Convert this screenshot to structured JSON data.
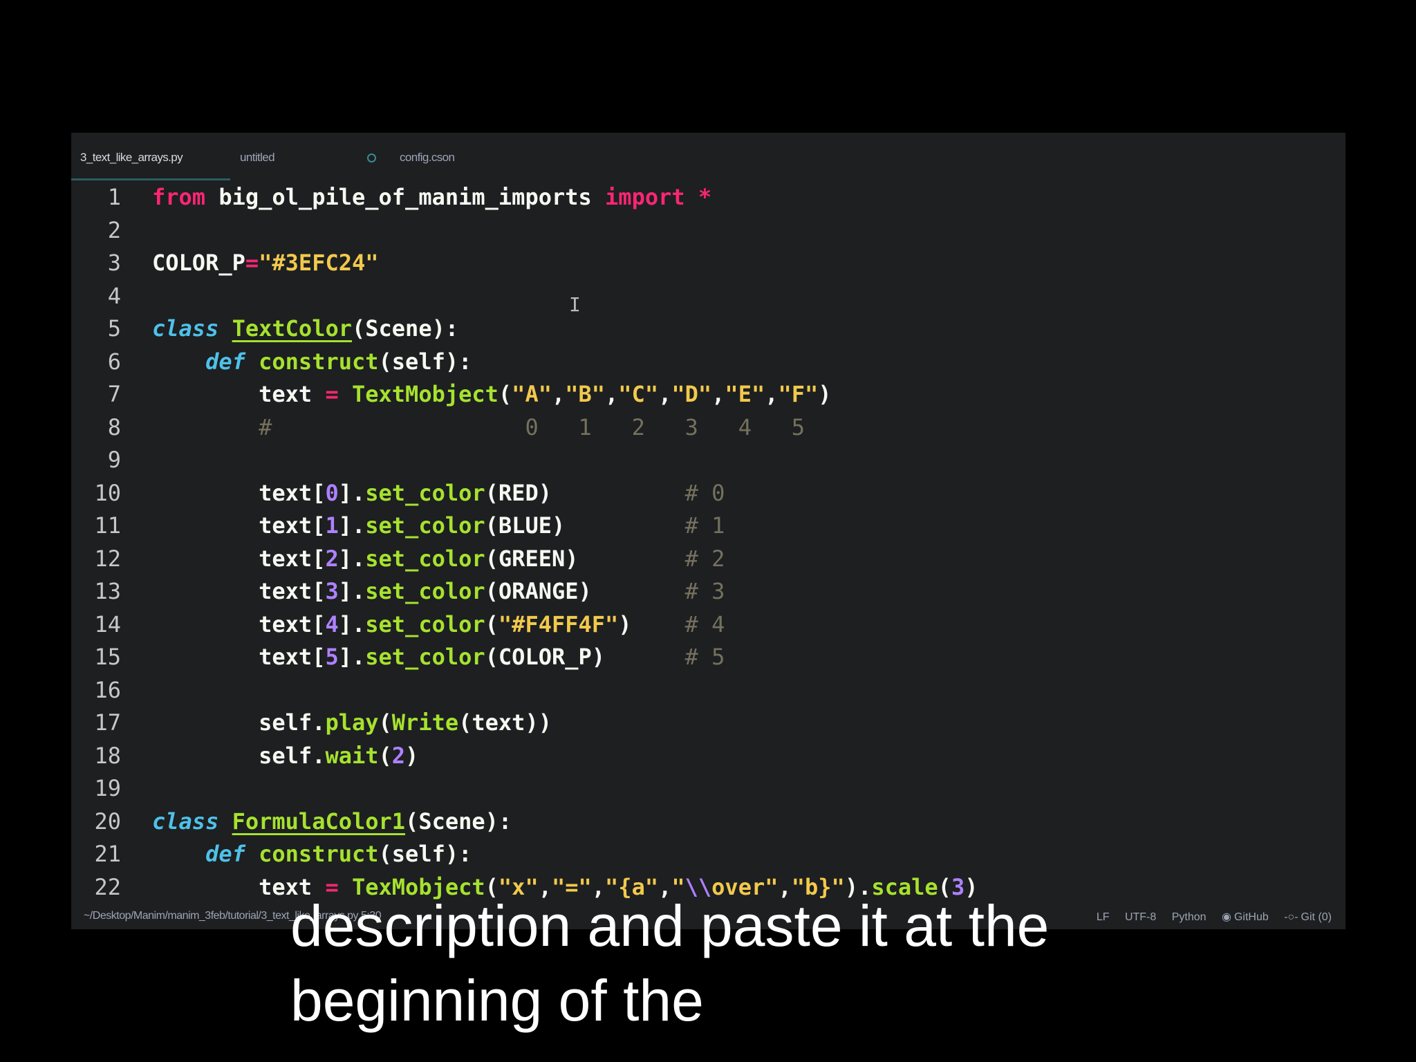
{
  "tabs": [
    {
      "label": "3_text_like_arrays.py",
      "active": true
    },
    {
      "label": "untitled",
      "active": false
    },
    {
      "label": "config.cson",
      "active": false,
      "modified": true
    }
  ],
  "code_lines": [
    {
      "n": "1",
      "tokens": [
        [
          "kw",
          "from"
        ],
        [
          "plain",
          " big_ol_pile_of_manim_imports "
        ],
        [
          "kw",
          "import"
        ],
        [
          "plain",
          " "
        ],
        [
          "kw",
          "*"
        ]
      ]
    },
    {
      "n": "2",
      "tokens": []
    },
    {
      "n": "3",
      "tokens": [
        [
          "plain",
          "COLOR_P"
        ],
        [
          "op",
          "="
        ],
        [
          "str",
          "\"#3EFC24\""
        ]
      ]
    },
    {
      "n": "4",
      "tokens": []
    },
    {
      "n": "5",
      "tokens": [
        [
          "def",
          "class"
        ],
        [
          "plain",
          " "
        ],
        [
          "cls",
          "TextColor"
        ],
        [
          "plain",
          "(Scene):"
        ]
      ]
    },
    {
      "n": "6",
      "tokens": [
        [
          "plain",
          "    "
        ],
        [
          "def",
          "def"
        ],
        [
          "plain",
          " "
        ],
        [
          "fn",
          "construct"
        ],
        [
          "plain",
          "(self):"
        ]
      ]
    },
    {
      "n": "7",
      "tokens": [
        [
          "plain",
          "        text "
        ],
        [
          "op",
          "="
        ],
        [
          "plain",
          " "
        ],
        [
          "fn",
          "TextMobject"
        ],
        [
          "plain",
          "("
        ],
        [
          "str",
          "\"A\""
        ],
        [
          "plain",
          ","
        ],
        [
          "str",
          "\"B\""
        ],
        [
          "plain",
          ","
        ],
        [
          "str",
          "\"C\""
        ],
        [
          "plain",
          ","
        ],
        [
          "str",
          "\"D\""
        ],
        [
          "plain",
          ","
        ],
        [
          "str",
          "\"E\""
        ],
        [
          "plain",
          ","
        ],
        [
          "str",
          "\"F\""
        ],
        [
          "plain",
          ")"
        ]
      ]
    },
    {
      "n": "8",
      "tokens": [
        [
          "plain",
          "        "
        ],
        [
          "cm",
          "#                   0   1   2   3   4   5"
        ]
      ]
    },
    {
      "n": "9",
      "tokens": []
    },
    {
      "n": "10",
      "tokens": [
        [
          "plain",
          "        text["
        ],
        [
          "num",
          "0"
        ],
        [
          "plain",
          "]."
        ],
        [
          "fn",
          "set_color"
        ],
        [
          "plain",
          "(RED)          "
        ],
        [
          "cm",
          "# 0"
        ]
      ]
    },
    {
      "n": "11",
      "tokens": [
        [
          "plain",
          "        text["
        ],
        [
          "num",
          "1"
        ],
        [
          "plain",
          "]."
        ],
        [
          "fn",
          "set_color"
        ],
        [
          "plain",
          "(BLUE)         "
        ],
        [
          "cm",
          "# 1"
        ]
      ]
    },
    {
      "n": "12",
      "tokens": [
        [
          "plain",
          "        text["
        ],
        [
          "num",
          "2"
        ],
        [
          "plain",
          "]."
        ],
        [
          "fn",
          "set_color"
        ],
        [
          "plain",
          "(GREEN)        "
        ],
        [
          "cm",
          "# 2"
        ]
      ]
    },
    {
      "n": "13",
      "tokens": [
        [
          "plain",
          "        text["
        ],
        [
          "num",
          "3"
        ],
        [
          "plain",
          "]."
        ],
        [
          "fn",
          "set_color"
        ],
        [
          "plain",
          "(ORANGE)       "
        ],
        [
          "cm",
          "# 3"
        ]
      ]
    },
    {
      "n": "14",
      "tokens": [
        [
          "plain",
          "        text["
        ],
        [
          "num",
          "4"
        ],
        [
          "plain",
          "]."
        ],
        [
          "fn",
          "set_color"
        ],
        [
          "plain",
          "("
        ],
        [
          "str",
          "\"#F4FF4F\""
        ],
        [
          "plain",
          ")    "
        ],
        [
          "cm",
          "# 4"
        ]
      ]
    },
    {
      "n": "15",
      "tokens": [
        [
          "plain",
          "        text["
        ],
        [
          "num",
          "5"
        ],
        [
          "plain",
          "]."
        ],
        [
          "fn",
          "set_color"
        ],
        [
          "plain",
          "(COLOR_P)      "
        ],
        [
          "cm",
          "# 5"
        ]
      ]
    },
    {
      "n": "16",
      "tokens": []
    },
    {
      "n": "17",
      "tokens": [
        [
          "plain",
          "        self."
        ],
        [
          "fn",
          "play"
        ],
        [
          "plain",
          "("
        ],
        [
          "fn",
          "Write"
        ],
        [
          "plain",
          "(text))"
        ]
      ]
    },
    {
      "n": "18",
      "tokens": [
        [
          "plain",
          "        self."
        ],
        [
          "fn",
          "wait"
        ],
        [
          "plain",
          "("
        ],
        [
          "num",
          "2"
        ],
        [
          "plain",
          ")"
        ]
      ]
    },
    {
      "n": "19",
      "tokens": []
    },
    {
      "n": "20",
      "tokens": [
        [
          "def",
          "class"
        ],
        [
          "plain",
          " "
        ],
        [
          "cls",
          "FormulaColor1"
        ],
        [
          "plain",
          "(Scene):"
        ]
      ]
    },
    {
      "n": "21",
      "tokens": [
        [
          "plain",
          "    "
        ],
        [
          "def",
          "def"
        ],
        [
          "plain",
          " "
        ],
        [
          "fn",
          "construct"
        ],
        [
          "plain",
          "(self):"
        ]
      ]
    },
    {
      "n": "22",
      "tokens": [
        [
          "plain",
          "        text "
        ],
        [
          "op",
          "="
        ],
        [
          "plain",
          " "
        ],
        [
          "fn",
          "TexMobject"
        ],
        [
          "plain",
          "("
        ],
        [
          "str",
          "\"x\""
        ],
        [
          "plain",
          ","
        ],
        [
          "str",
          "\"=\""
        ],
        [
          "plain",
          ","
        ],
        [
          "str",
          "\"{a\""
        ],
        [
          "plain",
          ","
        ],
        [
          "str",
          "\""
        ],
        [
          "esc",
          "\\\\"
        ],
        [
          "str",
          "over\""
        ],
        [
          "plain",
          ","
        ],
        [
          "str",
          "\"b}\""
        ],
        [
          "plain",
          ")."
        ],
        [
          "fn",
          "scale"
        ],
        [
          "plain",
          "("
        ],
        [
          "num",
          "3"
        ],
        [
          "plain",
          ")"
        ]
      ]
    }
  ],
  "status": {
    "path": "~/Desktop/Manim/manim_3feb/tutorial/3_text_like_arrays.py  5:30",
    "line_ending": "LF",
    "encoding": "UTF-8",
    "grammar": "Python",
    "github": "GitHub",
    "git": "Git (0)"
  },
  "subtitle": {
    "line1": "description and paste it at the",
    "line2": "beginning of the"
  },
  "colors": {
    "keyword": "#f92672",
    "string": "#f2c94c",
    "def": "#4fc1e9",
    "function": "#a6e22e",
    "number": "#ae81ff",
    "comment": "#75715e"
  }
}
